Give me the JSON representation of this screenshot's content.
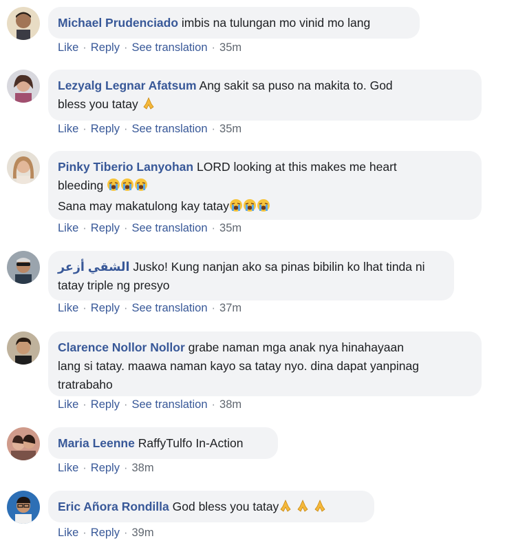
{
  "actions": {
    "like": "Like",
    "reply": "Reply",
    "see_translation": "See translation"
  },
  "colors": {
    "author": "#385898",
    "bubble": "#f2f3f5",
    "meta": "#606770"
  },
  "comments": [
    {
      "author": "Michael Prudenciado",
      "lines": [
        "imbis na tulungan mo vinid mo lang"
      ],
      "time": "35m",
      "translation": true
    },
    {
      "author": "Lezyalg Legnar Afatsum",
      "lines": [
        "Ang sakit sa puso na makita to. God",
        "bless you tatay"
      ],
      "emoji": "folded-hands",
      "time": "35m",
      "translation": true
    },
    {
      "author": "Pinky Tiberio Lanyohan",
      "lines": [
        "LORD looking at this makes me heart",
        "bleeding",
        "Sana may makatulong kay tatay"
      ],
      "emoji": "crying-face",
      "time": "35m",
      "translation": true
    },
    {
      "author": "الشقي أزعر",
      "lines": [
        "Jusko! Kung nanjan ako sa pinas bibilin ko lhat tinda ni",
        "tatay triple ng presyo"
      ],
      "time": "37m",
      "translation": true
    },
    {
      "author": "Clarence Nollor Nollor",
      "lines": [
        "grabe naman mga anak nya hinahayaan",
        "lang si tatay. maawa naman kayo sa tatay nyo. dina dapat yanpinag",
        "tratrabaho"
      ],
      "time": "38m",
      "translation": true
    },
    {
      "author": "Maria Leenne",
      "lines": [
        "RaffyTulfo In-Action"
      ],
      "time": "38m",
      "translation": false
    },
    {
      "author": "Eric Añora Rondilla",
      "lines": [
        "God bless you tatay"
      ],
      "emoji": "folded-hands",
      "time": "39m",
      "translation": false
    }
  ]
}
